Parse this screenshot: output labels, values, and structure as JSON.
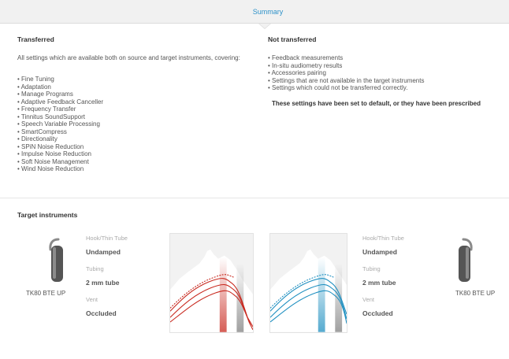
{
  "tab": {
    "label": "Summary"
  },
  "transferred": {
    "title": "Transferred",
    "intro": "All settings which are available both on source and target instruments, covering:",
    "items": [
      "Fine Tuning",
      "Adaptation",
      "Manage Programs",
      "Adaptive Feedback Canceller",
      "Frequency Transfer",
      "Tinnitus SoundSupport",
      "Speech Variable Processing",
      "SmartCompress",
      "Directionality",
      "SPiN Noise Reduction",
      "Impulse Noise Reduction",
      "Soft Noise Management",
      "Wind Noise Reduction"
    ]
  },
  "not_transferred": {
    "title": "Not transferred",
    "items": [
      "Feedback measurements",
      "In-situ audiometry results",
      "Accessories pairing",
      "Settings that are not available in the target instruments",
      "Settings which could not be transferred correctly."
    ],
    "note": "These settings have been set to default, or they have been prescribed"
  },
  "target": {
    "title": "Target instruments",
    "left": {
      "device": "TK80 BTE UP",
      "hook_label": "Hook/Thin Tube",
      "hook_value": "Undamped",
      "tubing_label": "Tubing",
      "tubing_value": "2 mm tube",
      "vent_label": "Vent",
      "vent_value": "Occluded",
      "curve_color": "#c8281e"
    },
    "right": {
      "device": "TK80 BTE UP",
      "hook_label": "Hook/Thin Tube",
      "hook_value": "Undamped",
      "tubing_label": "Tubing",
      "tubing_value": "2 mm tube",
      "vent_label": "Vent",
      "vent_value": "Occluded",
      "curve_color": "#1e8fc0"
    }
  },
  "colors": {
    "accent": "#2e92c9",
    "tab_bg": "#f1f1f1"
  }
}
